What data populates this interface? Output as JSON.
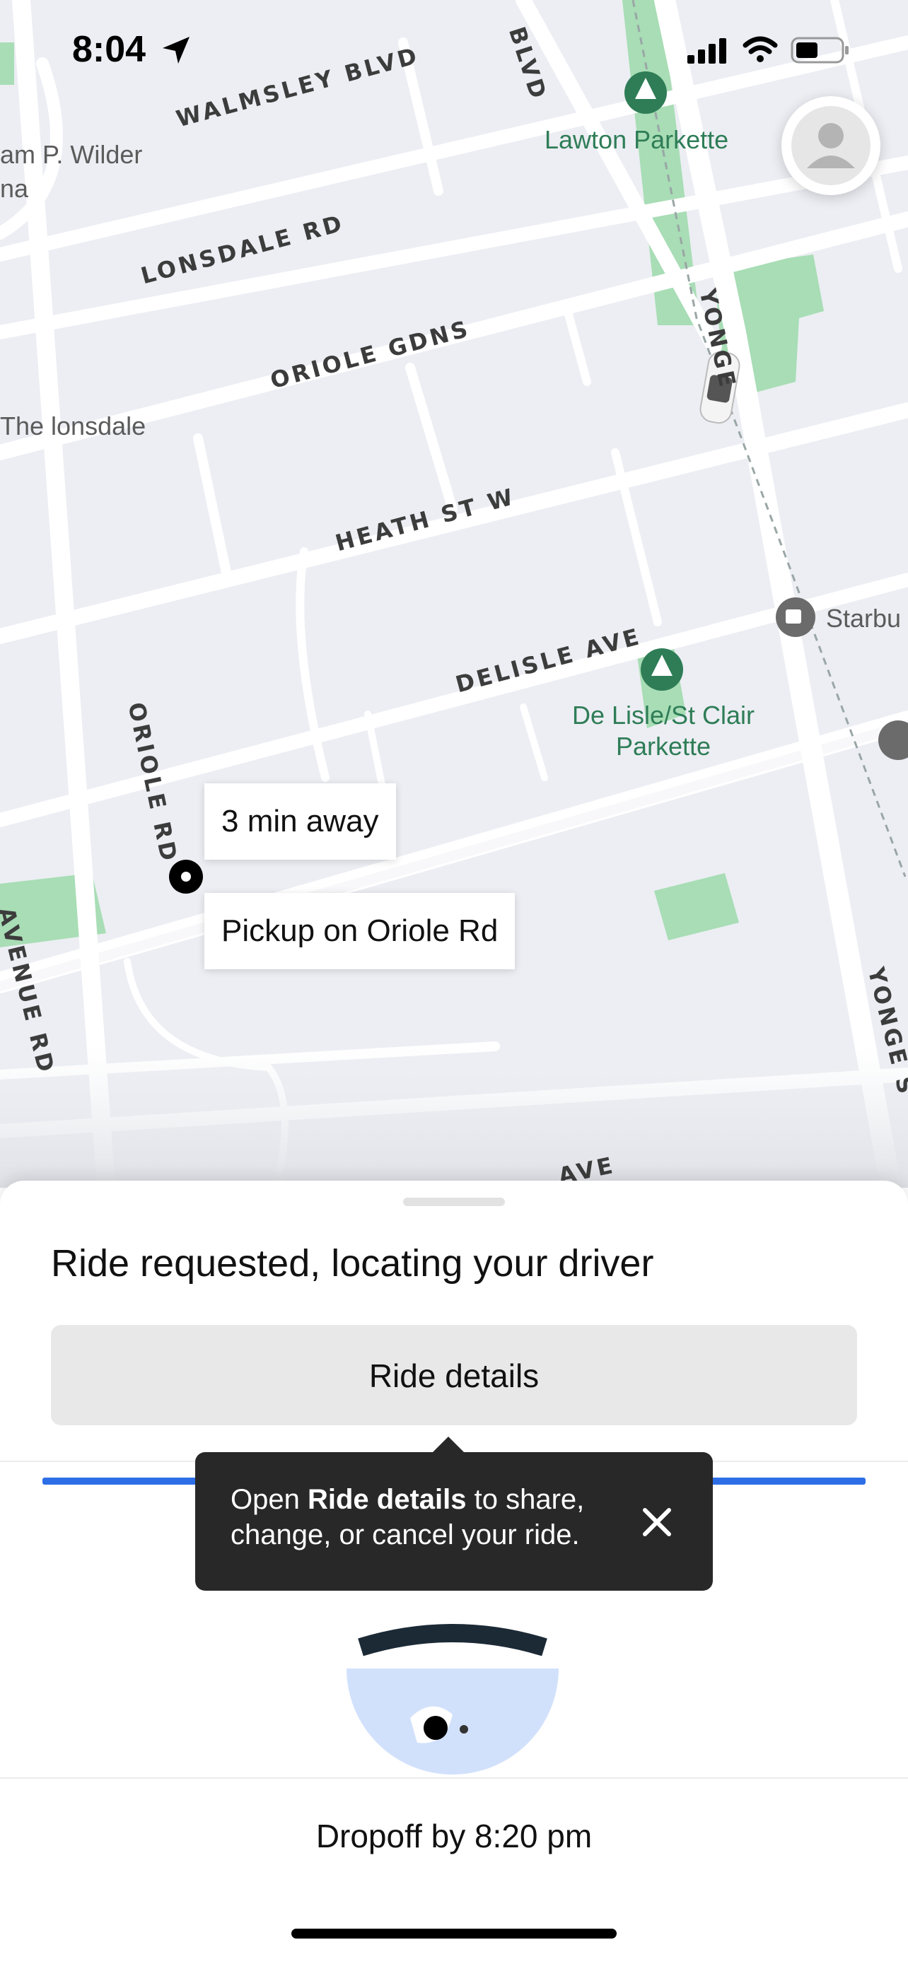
{
  "status_bar": {
    "time": "8:04",
    "icons": [
      "location-arrow-icon",
      "signal-icon",
      "wifi-icon",
      "battery-icon"
    ]
  },
  "map": {
    "road_labels": {
      "walmsley": "WALMSLEY BLVD",
      "blvd_top": "BLVD",
      "lonsdale": "LONSDALE RD",
      "oriole_gdns": "ORIOLE GDNS",
      "heath": "HEATH ST W",
      "delisle": "DELISLE AVE",
      "oriole_rd": "ORIOLE RD",
      "avenue_rd": "AVENUE RD",
      "yonge_top": "YONGE",
      "yonge_bottom": "YONGE S",
      "ave_bottom": "AVE"
    },
    "place_labels": {
      "wilder": "am P. Wilder",
      "wilder2": "na",
      "lonsdale_place": "The lonsdale",
      "starbucks": "Starbu"
    },
    "park_labels": {
      "lawton": "Lawton Parkette",
      "delisle_park_1": "De Lisle/St Clair",
      "delisle_park_2": "Parkette"
    },
    "eta_bubble": "3 min away",
    "pickup_bubble": "Pickup on Oriole Rd"
  },
  "sheet": {
    "title": "Ride requested, locating your driver",
    "ride_details_button": "Ride details",
    "tooltip": {
      "prefix": "Open ",
      "bold": "Ride details",
      "suffix": " to share, change, or cancel your ride."
    },
    "dropoff": "Dropoff by 8:20 pm"
  },
  "colors": {
    "map_bg": "#eceef3",
    "park": "#a8ddb5",
    "progress": "#2d6ee6",
    "tooltip_bg": "#282828"
  }
}
